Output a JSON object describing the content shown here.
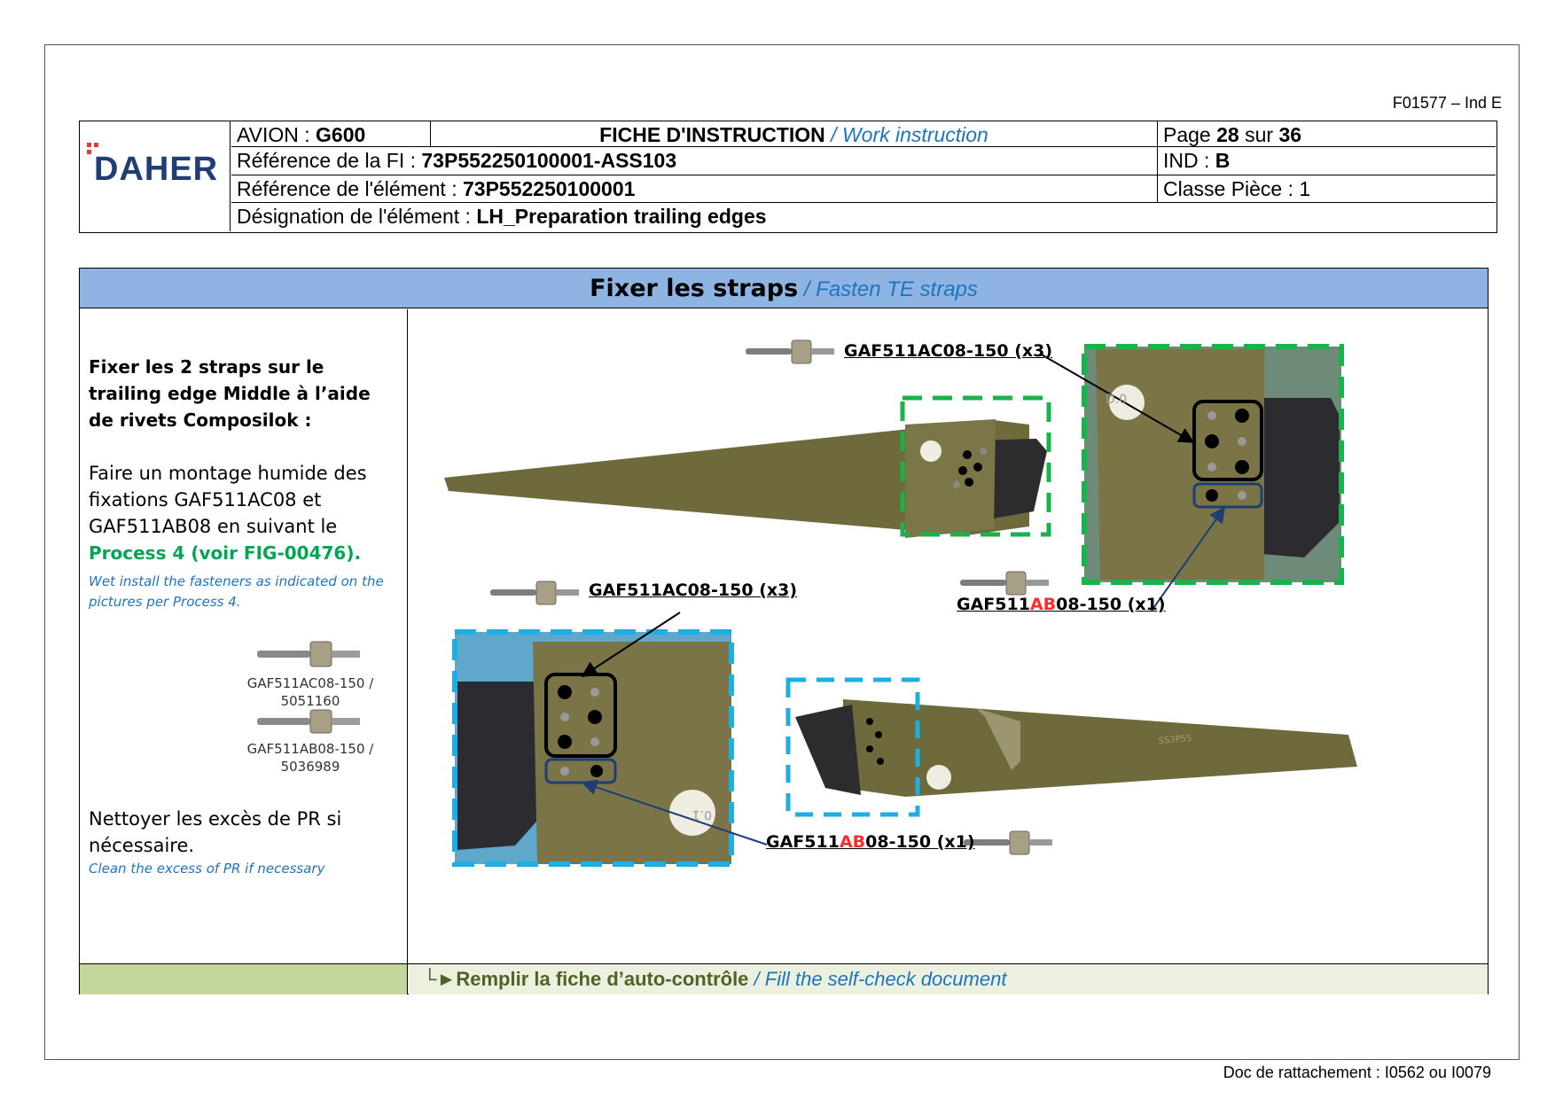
{
  "form_code": "F01577 – Ind E",
  "logo": {
    "text": "DAHER"
  },
  "header": {
    "avion_label": "AVION : ",
    "avion_value": "G600",
    "title_fr": "FICHE D'INSTRUCTION",
    "title_en": " / Work instruction",
    "page_label_1": "Page ",
    "page_current": "28",
    "page_label_2": " sur ",
    "page_total": "36",
    "ref_fi_label": "Référence de la FI : ",
    "ref_fi_value": "73P552250100001-ASS103",
    "ind_label": "IND : ",
    "ind_value": "B",
    "ref_elem_label": "Référence de l'élément : ",
    "ref_elem_value": "73P552250100001",
    "classe_label": "Classe Pièce : 1",
    "desig_label": "Désignation de l'élément : ",
    "desig_value": "LH_Preparation trailing edges"
  },
  "section": {
    "title_fr": "Fixer les straps",
    "title_en": " / Fasten TE straps",
    "instr_1": "Fixer les 2 straps sur le trailing edge Middle à l’aide de rivets Composilok :",
    "instr_2": "Faire un montage humide des fixations GAF511AC08 et GAF511AB08 en suivant le",
    "instr_2_link": "Process 4 (voir FIG-00476).",
    "instr_2_en": "Wet install the fasteners as indicated on the pictures per Process 4.",
    "fastener_1_label": "GAF511AC08-150 / 5051160",
    "fastener_2_label": "GAF511AB08-150 / 5036989",
    "instr_3": "Nettoyer les excès de PR si nécessaire.",
    "instr_3_en": "Clean the excess of PR if necessary",
    "callout_ac_top": "GAF511AC08-150 (x3)",
    "callout_ac_bottom": "GAF511AC08-150 (x3)",
    "callout_ab_pre": "GAF511",
    "callout_ab_red": "AB",
    "callout_ab_post": "08-150 (x1)",
    "footer_arrow": "└►",
    "footer_fr": "Remplir la fiche d’auto-contrôle",
    "footer_en": " / Fill the self-check document"
  },
  "photo_markings": {
    "top_strap": "D.0",
    "bottom_strap": "0.1",
    "te_marking": "SS3P55"
  },
  "doc_link": "Doc de rattachement : I0562 ou I0079",
  "colors": {
    "header_blue": "#8eb4e3",
    "footer_green": "#c3d69b",
    "accent_blue": "#1f74bd",
    "dash_green": "#1ab24a",
    "dash_cyan": "#1eaee4",
    "brand_navy": "#1f3e75"
  }
}
